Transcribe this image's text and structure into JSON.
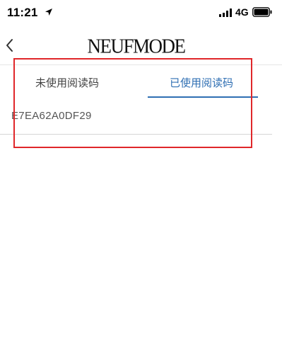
{
  "status_bar": {
    "time": "11:21",
    "network": "4G",
    "icons": [
      "location-arrow-icon",
      "signal-bars-icon",
      "battery-icon"
    ]
  },
  "nav": {
    "title": "NEUFMODE",
    "back_icon": "chevron-left-icon"
  },
  "tabs": [
    {
      "label": "未使用阅读码",
      "active": false
    },
    {
      "label": "已使用阅读码",
      "active": true
    }
  ],
  "codes": [
    {
      "value": "E7EA62A0DF29"
    }
  ],
  "colors": {
    "accent": "#2f6fb3",
    "highlight": "#e0272a",
    "text": "#444444"
  }
}
